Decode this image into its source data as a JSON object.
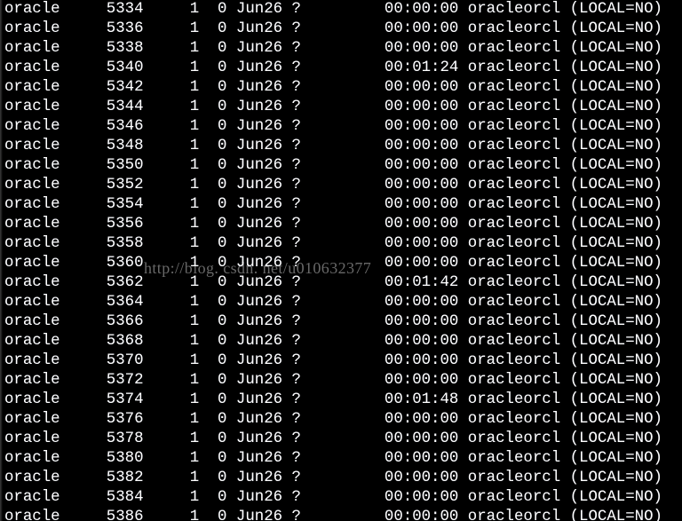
{
  "terminal": {
    "background_color": "#000000",
    "text_color": "#ffffff",
    "columns": {
      "user": "oracle",
      "ppid": "1",
      "c": "0",
      "start_date": "Jun26",
      "tty": "?",
      "command": "oracleorcl",
      "connection": "(LOCAL=NO)"
    },
    "rows": [
      {
        "user": "oracle",
        "pid": "5334",
        "ppid": "1",
        "c": "0",
        "stime": "Jun26",
        "tty": "?",
        "time": "00:00:00",
        "cmd": "oracleorcl",
        "conn": "(LOCAL=NO)"
      },
      {
        "user": "oracle",
        "pid": "5336",
        "ppid": "1",
        "c": "0",
        "stime": "Jun26",
        "tty": "?",
        "time": "00:00:00",
        "cmd": "oracleorcl",
        "conn": "(LOCAL=NO)"
      },
      {
        "user": "oracle",
        "pid": "5338",
        "ppid": "1",
        "c": "0",
        "stime": "Jun26",
        "tty": "?",
        "time": "00:00:00",
        "cmd": "oracleorcl",
        "conn": "(LOCAL=NO)"
      },
      {
        "user": "oracle",
        "pid": "5340",
        "ppid": "1",
        "c": "0",
        "stime": "Jun26",
        "tty": "?",
        "time": "00:01:24",
        "cmd": "oracleorcl",
        "conn": "(LOCAL=NO)"
      },
      {
        "user": "oracle",
        "pid": "5342",
        "ppid": "1",
        "c": "0",
        "stime": "Jun26",
        "tty": "?",
        "time": "00:00:00",
        "cmd": "oracleorcl",
        "conn": "(LOCAL=NO)"
      },
      {
        "user": "oracle",
        "pid": "5344",
        "ppid": "1",
        "c": "0",
        "stime": "Jun26",
        "tty": "?",
        "time": "00:00:00",
        "cmd": "oracleorcl",
        "conn": "(LOCAL=NO)"
      },
      {
        "user": "oracle",
        "pid": "5346",
        "ppid": "1",
        "c": "0",
        "stime": "Jun26",
        "tty": "?",
        "time": "00:00:00",
        "cmd": "oracleorcl",
        "conn": "(LOCAL=NO)"
      },
      {
        "user": "oracle",
        "pid": "5348",
        "ppid": "1",
        "c": "0",
        "stime": "Jun26",
        "tty": "?",
        "time": "00:00:00",
        "cmd": "oracleorcl",
        "conn": "(LOCAL=NO)"
      },
      {
        "user": "oracle",
        "pid": "5350",
        "ppid": "1",
        "c": "0",
        "stime": "Jun26",
        "tty": "?",
        "time": "00:00:00",
        "cmd": "oracleorcl",
        "conn": "(LOCAL=NO)"
      },
      {
        "user": "oracle",
        "pid": "5352",
        "ppid": "1",
        "c": "0",
        "stime": "Jun26",
        "tty": "?",
        "time": "00:00:00",
        "cmd": "oracleorcl",
        "conn": "(LOCAL=NO)"
      },
      {
        "user": "oracle",
        "pid": "5354",
        "ppid": "1",
        "c": "0",
        "stime": "Jun26",
        "tty": "?",
        "time": "00:00:00",
        "cmd": "oracleorcl",
        "conn": "(LOCAL=NO)"
      },
      {
        "user": "oracle",
        "pid": "5356",
        "ppid": "1",
        "c": "0",
        "stime": "Jun26",
        "tty": "?",
        "time": "00:00:00",
        "cmd": "oracleorcl",
        "conn": "(LOCAL=NO)"
      },
      {
        "user": "oracle",
        "pid": "5358",
        "ppid": "1",
        "c": "0",
        "stime": "Jun26",
        "tty": "?",
        "time": "00:00:00",
        "cmd": "oracleorcl",
        "conn": "(LOCAL=NO)"
      },
      {
        "user": "oracle",
        "pid": "5360",
        "ppid": "1",
        "c": "0",
        "stime": "Jun26",
        "tty": "?",
        "time": "00:00:00",
        "cmd": "oracleorcl",
        "conn": "(LOCAL=NO)"
      },
      {
        "user": "oracle",
        "pid": "5362",
        "ppid": "1",
        "c": "0",
        "stime": "Jun26",
        "tty": "?",
        "time": "00:01:42",
        "cmd": "oracleorcl",
        "conn": "(LOCAL=NO)"
      },
      {
        "user": "oracle",
        "pid": "5364",
        "ppid": "1",
        "c": "0",
        "stime": "Jun26",
        "tty": "?",
        "time": "00:00:00",
        "cmd": "oracleorcl",
        "conn": "(LOCAL=NO)"
      },
      {
        "user": "oracle",
        "pid": "5366",
        "ppid": "1",
        "c": "0",
        "stime": "Jun26",
        "tty": "?",
        "time": "00:00:00",
        "cmd": "oracleorcl",
        "conn": "(LOCAL=NO)"
      },
      {
        "user": "oracle",
        "pid": "5368",
        "ppid": "1",
        "c": "0",
        "stime": "Jun26",
        "tty": "?",
        "time": "00:00:00",
        "cmd": "oracleorcl",
        "conn": "(LOCAL=NO)"
      },
      {
        "user": "oracle",
        "pid": "5370",
        "ppid": "1",
        "c": "0",
        "stime": "Jun26",
        "tty": "?",
        "time": "00:00:00",
        "cmd": "oracleorcl",
        "conn": "(LOCAL=NO)"
      },
      {
        "user": "oracle",
        "pid": "5372",
        "ppid": "1",
        "c": "0",
        "stime": "Jun26",
        "tty": "?",
        "time": "00:00:00",
        "cmd": "oracleorcl",
        "conn": "(LOCAL=NO)"
      },
      {
        "user": "oracle",
        "pid": "5374",
        "ppid": "1",
        "c": "0",
        "stime": "Jun26",
        "tty": "?",
        "time": "00:01:48",
        "cmd": "oracleorcl",
        "conn": "(LOCAL=NO)"
      },
      {
        "user": "oracle",
        "pid": "5376",
        "ppid": "1",
        "c": "0",
        "stime": "Jun26",
        "tty": "?",
        "time": "00:00:00",
        "cmd": "oracleorcl",
        "conn": "(LOCAL=NO)"
      },
      {
        "user": "oracle",
        "pid": "5378",
        "ppid": "1",
        "c": "0",
        "stime": "Jun26",
        "tty": "?",
        "time": "00:00:00",
        "cmd": "oracleorcl",
        "conn": "(LOCAL=NO)"
      },
      {
        "user": "oracle",
        "pid": "5380",
        "ppid": "1",
        "c": "0",
        "stime": "Jun26",
        "tty": "?",
        "time": "00:00:00",
        "cmd": "oracleorcl",
        "conn": "(LOCAL=NO)"
      },
      {
        "user": "oracle",
        "pid": "5382",
        "ppid": "1",
        "c": "0",
        "stime": "Jun26",
        "tty": "?",
        "time": "00:00:00",
        "cmd": "oracleorcl",
        "conn": "(LOCAL=NO)"
      },
      {
        "user": "oracle",
        "pid": "5384",
        "ppid": "1",
        "c": "0",
        "stime": "Jun26",
        "tty": "?",
        "time": "00:00:00",
        "cmd": "oracleorcl",
        "conn": "(LOCAL=NO)"
      },
      {
        "user": "oracle",
        "pid": "5386",
        "ppid": "1",
        "c": "0",
        "stime": "Jun26",
        "tty": "?",
        "time": "00:00:00",
        "cmd": "oracleorcl",
        "conn": "(LOCAL=NO)"
      }
    ]
  },
  "watermark": {
    "text": "http://blog. csdn. net/u010632377"
  }
}
